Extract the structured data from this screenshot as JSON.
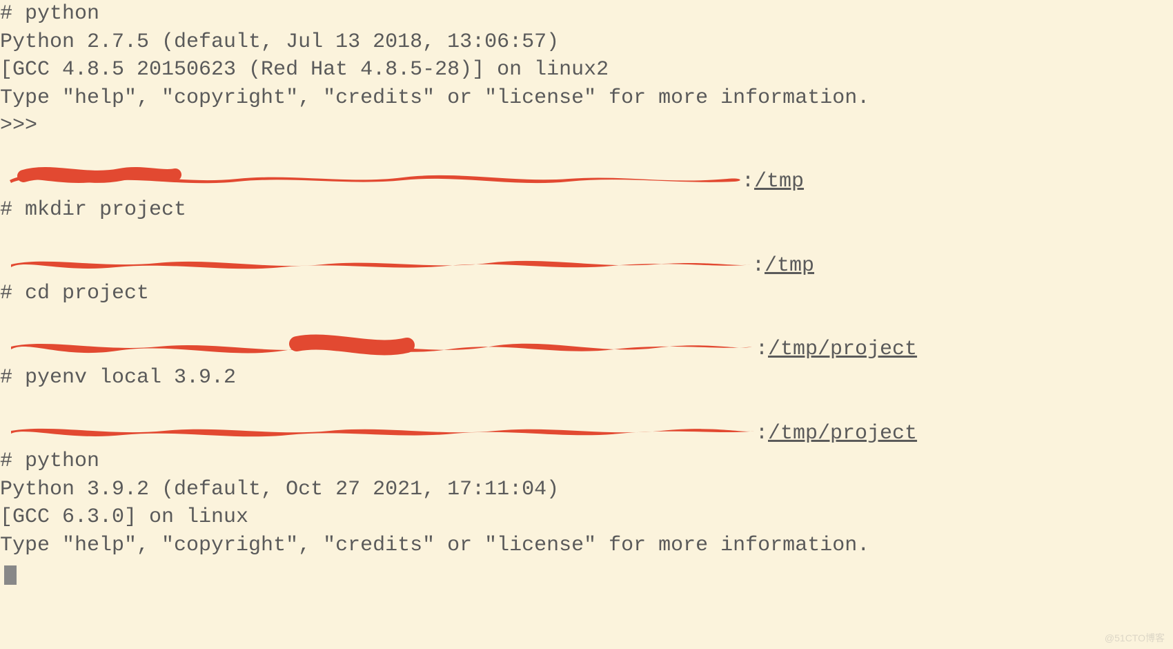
{
  "terminal": {
    "section1": {
      "cmd": "# python",
      "version": "Python 2.7.5 (default, Jul 13 2018, 13:06:57)",
      "compiler": "[GCC 4.8.5 20150623 (Red Hat 4.8.5-28)] on linux2",
      "help": "Type \"help\", \"copyright\", \"credits\" or \"license\" for more information.",
      "prompt": ">>>"
    },
    "section2": {
      "path_suffix": ":/tmp",
      "cmd": "# mkdir project"
    },
    "section3": {
      "path_suffix": ":/tmp",
      "cmd": "# cd project"
    },
    "section4": {
      "path_suffix": ":/tmp/project",
      "cmd": "# pyenv local 3.9.2"
    },
    "section5": {
      "path_suffix": ":/tmp/project",
      "cmd": "# python",
      "version": "Python 3.9.2 (default, Oct 27 2021, 17:11:04)",
      "compiler": "[GCC 6.3.0] on linux",
      "help": "Type \"help\", \"copyright\", \"credits\" or \"license\" for more information."
    }
  },
  "watermark": "@51CTO博客"
}
